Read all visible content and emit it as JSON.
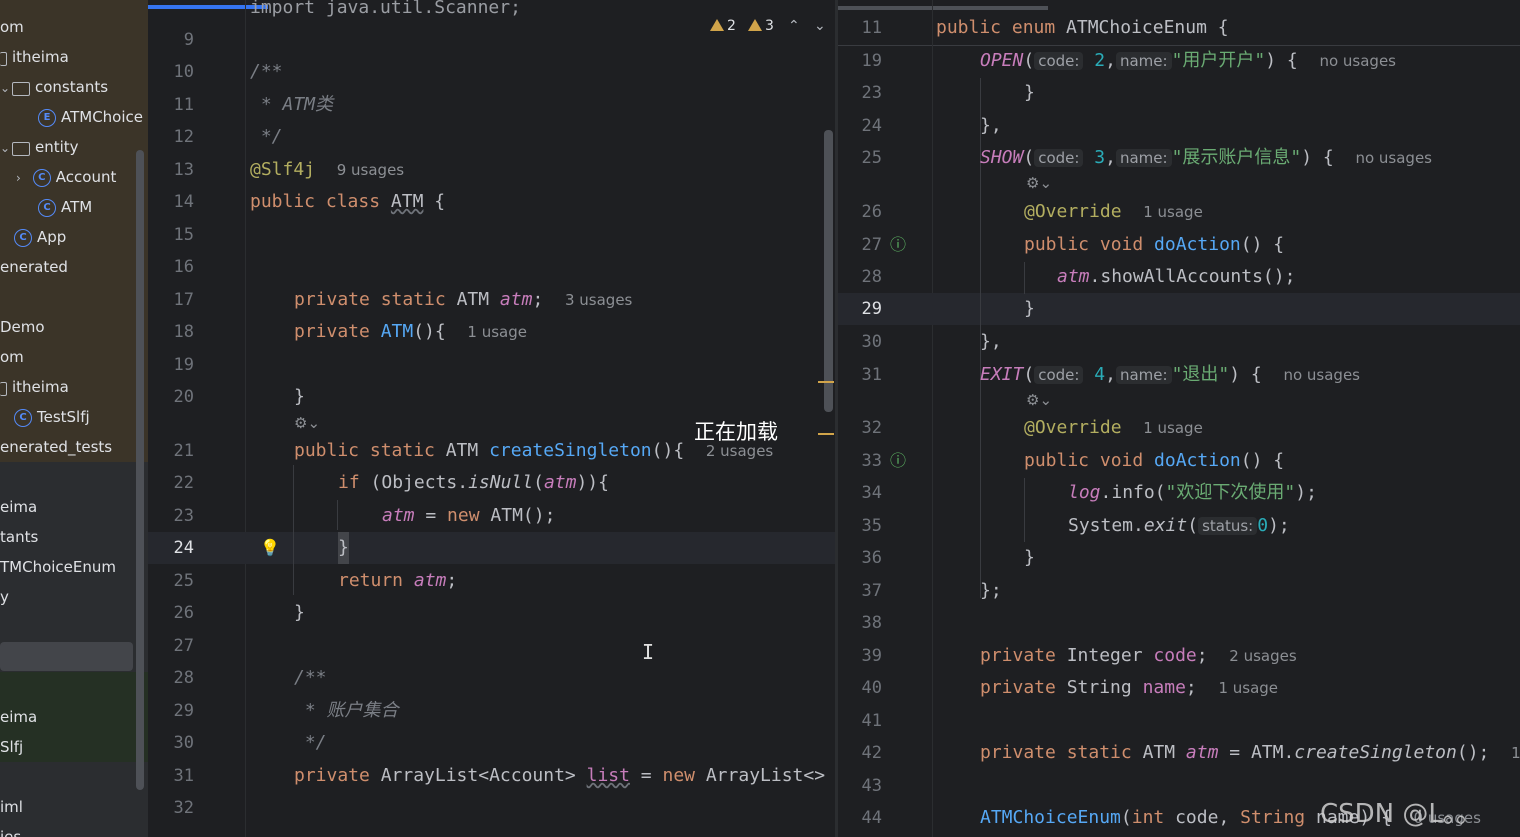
{
  "project_tree": {
    "items": [
      {
        "label": "om"
      },
      {
        "label": "itheima"
      },
      {
        "label": "constants"
      },
      {
        "label": "ATMChoice"
      },
      {
        "label": "entity"
      },
      {
        "label": "Account"
      },
      {
        "label": "ATM"
      },
      {
        "label": "App"
      },
      {
        "label": "enerated"
      },
      {
        "label": "Demo"
      },
      {
        "label": "om"
      },
      {
        "label": "itheima"
      },
      {
        "label": "TestSlfj"
      },
      {
        "label": "enerated_tests"
      },
      {
        "label": "eima"
      },
      {
        "label": "tants"
      },
      {
        "label": "TMChoiceEnum"
      },
      {
        "label": "y"
      },
      {
        "label": "eima"
      },
      {
        "label": "Slfj"
      },
      {
        "label": "iml"
      },
      {
        "label": "ies"
      }
    ]
  },
  "left_editor": {
    "top_partial": "import java.util.Scanner;",
    "warnings": {
      "warn1": "2",
      "warn2": "3"
    },
    "lines": {
      "n9": "9",
      "n10": "10",
      "n11": "11",
      "n12": "12",
      "n13": "13",
      "n14": "14",
      "n15": "15",
      "n16": "16",
      "n17": "17",
      "n18": "18",
      "n19": "19",
      "n20": "20",
      "n21": "21",
      "n22": "22",
      "n23": "23",
      "n24": "24",
      "n25": "25",
      "n26": "26",
      "n27": "27",
      "n28": "28",
      "n29": "29",
      "n30": "30",
      "n31": "31",
      "n32": "32"
    },
    "code": {
      "l10": "/**",
      "l11": " * ATM类",
      "l12": " */",
      "l13_ann": "@Slf4j",
      "l13_hint": "9 usages",
      "l14_kw": "public class ",
      "l14_name": "ATM",
      "l14_rest": " {",
      "l17_kw": "private static ",
      "l17_type": "ATM ",
      "l17_field": "atm",
      "l17_rest": ";",
      "l17_hint": "3 usages",
      "l18_kw": "private ",
      "l18_fn": "ATM",
      "l18_rest": "(){",
      "l18_hint": "1 usage",
      "l20": "}",
      "l21_kw": "public static ",
      "l21_type": "ATM ",
      "l21_fn": "createSingleton",
      "l21_rest": "(){",
      "l21_hint": "2 usages",
      "l22_kw": "if ",
      "l22_a": "(Objects.",
      "l22_b": "isNull",
      "l22_c": "(",
      "l22_d": "atm",
      "l22_e": ")){",
      "l23_a": "atm",
      "l23_b": " = ",
      "l23_c": "new ",
      "l23_d": "ATM();",
      "l24": "}",
      "l25_kw": "return ",
      "l25_f": "atm",
      "l25_rest": ";",
      "l26": "}",
      "l28": "/**",
      "l29": " * 账户集合",
      "l30": " */",
      "l31_kw": "private ",
      "l31_type": "ArrayList<Account> ",
      "l31_field": "list",
      "l31_eq": " = ",
      "l31_new": "new ",
      "l31_rest": "ArrayList<>"
    }
  },
  "right_editor": {
    "lines": {
      "n11": "11",
      "n19": "19",
      "n23": "23",
      "n24": "24",
      "n25": "25",
      "n26": "26",
      "n27": "27",
      "n28": "28",
      "n29": "29",
      "n30": "30",
      "n31": "31",
      "n32": "32",
      "n33": "33",
      "n34": "34",
      "n35": "35",
      "n36": "36",
      "n37": "37",
      "n38": "38",
      "n39": "39",
      "n40": "40",
      "n41": "41",
      "n42": "42",
      "n43": "43",
      "n44": "44"
    },
    "code": {
      "r11_kw": "public enum ",
      "r11_name": "ATMChoiceEnum",
      "r11_rest": " {",
      "r19_const": "OPEN",
      "r19_p": "(",
      "r19_code": "code:",
      "r19_num": "2",
      "r19_name": "name:",
      "r19_str": "\"用户开户\"",
      "r19_rest": ") {",
      "r19_hint": "no usages",
      "r23": "}",
      "r24": "},",
      "r25_const": "SHOW",
      "r25_num": "3",
      "r25_str": "\"展示账户信息\"",
      "r25_hint": "no usages",
      "r26_ann": "@Override",
      "r26_hint": "1 usage",
      "r27_kw": "public void ",
      "r27_fn": "doAction",
      "r27_rest": "() {",
      "r28_a": "atm",
      "r28_b": ".showAllAccounts();",
      "r29": "}",
      "r30": "},",
      "r31_const": "EXIT",
      "r31_num": "4",
      "r31_str": "\"退出\"",
      "r31_hint": "no usages",
      "r32_ann": "@Override",
      "r32_hint": "1 usage",
      "r33_kw": "public void ",
      "r33_fn": "doAction",
      "r33_rest": "() {",
      "r34_a": "log",
      "r34_b": ".info(",
      "r34_str": "\"欢迎下次使用\"",
      "r34_c": ");",
      "r35_a": "System.",
      "r35_b": "exit",
      "r35_c": "(",
      "r35_pill": "status:",
      "r35_num": "0",
      "r35_d": ");",
      "r36": "}",
      "r37": "};",
      "r39_kw": "private ",
      "r39_type": "Integer ",
      "r39_field": "code",
      "r39_rest": ";",
      "r39_hint": "2 usages",
      "r40_kw": "private ",
      "r40_type": "String ",
      "r40_field": "name",
      "r40_rest": ";",
      "r40_hint": "1 usage",
      "r42_kw": "private static ",
      "r42_type": "ATM ",
      "r42_field": "atm",
      "r42_eq": " = ATM.",
      "r42_fn": "createSingleton",
      "r42_rest": "();",
      "r42_hint": "1",
      "r44_fn": "ATMChoiceEnum",
      "r44_a": "(",
      "r44_kw1": "int ",
      "r44_b": "code, ",
      "r44_kw2": "String ",
      "r44_c": "name) {",
      "r44_hint": "0 usages"
    }
  },
  "overlay": {
    "loading_text": "正在加载",
    "watermark": "CSDN @L。。"
  }
}
